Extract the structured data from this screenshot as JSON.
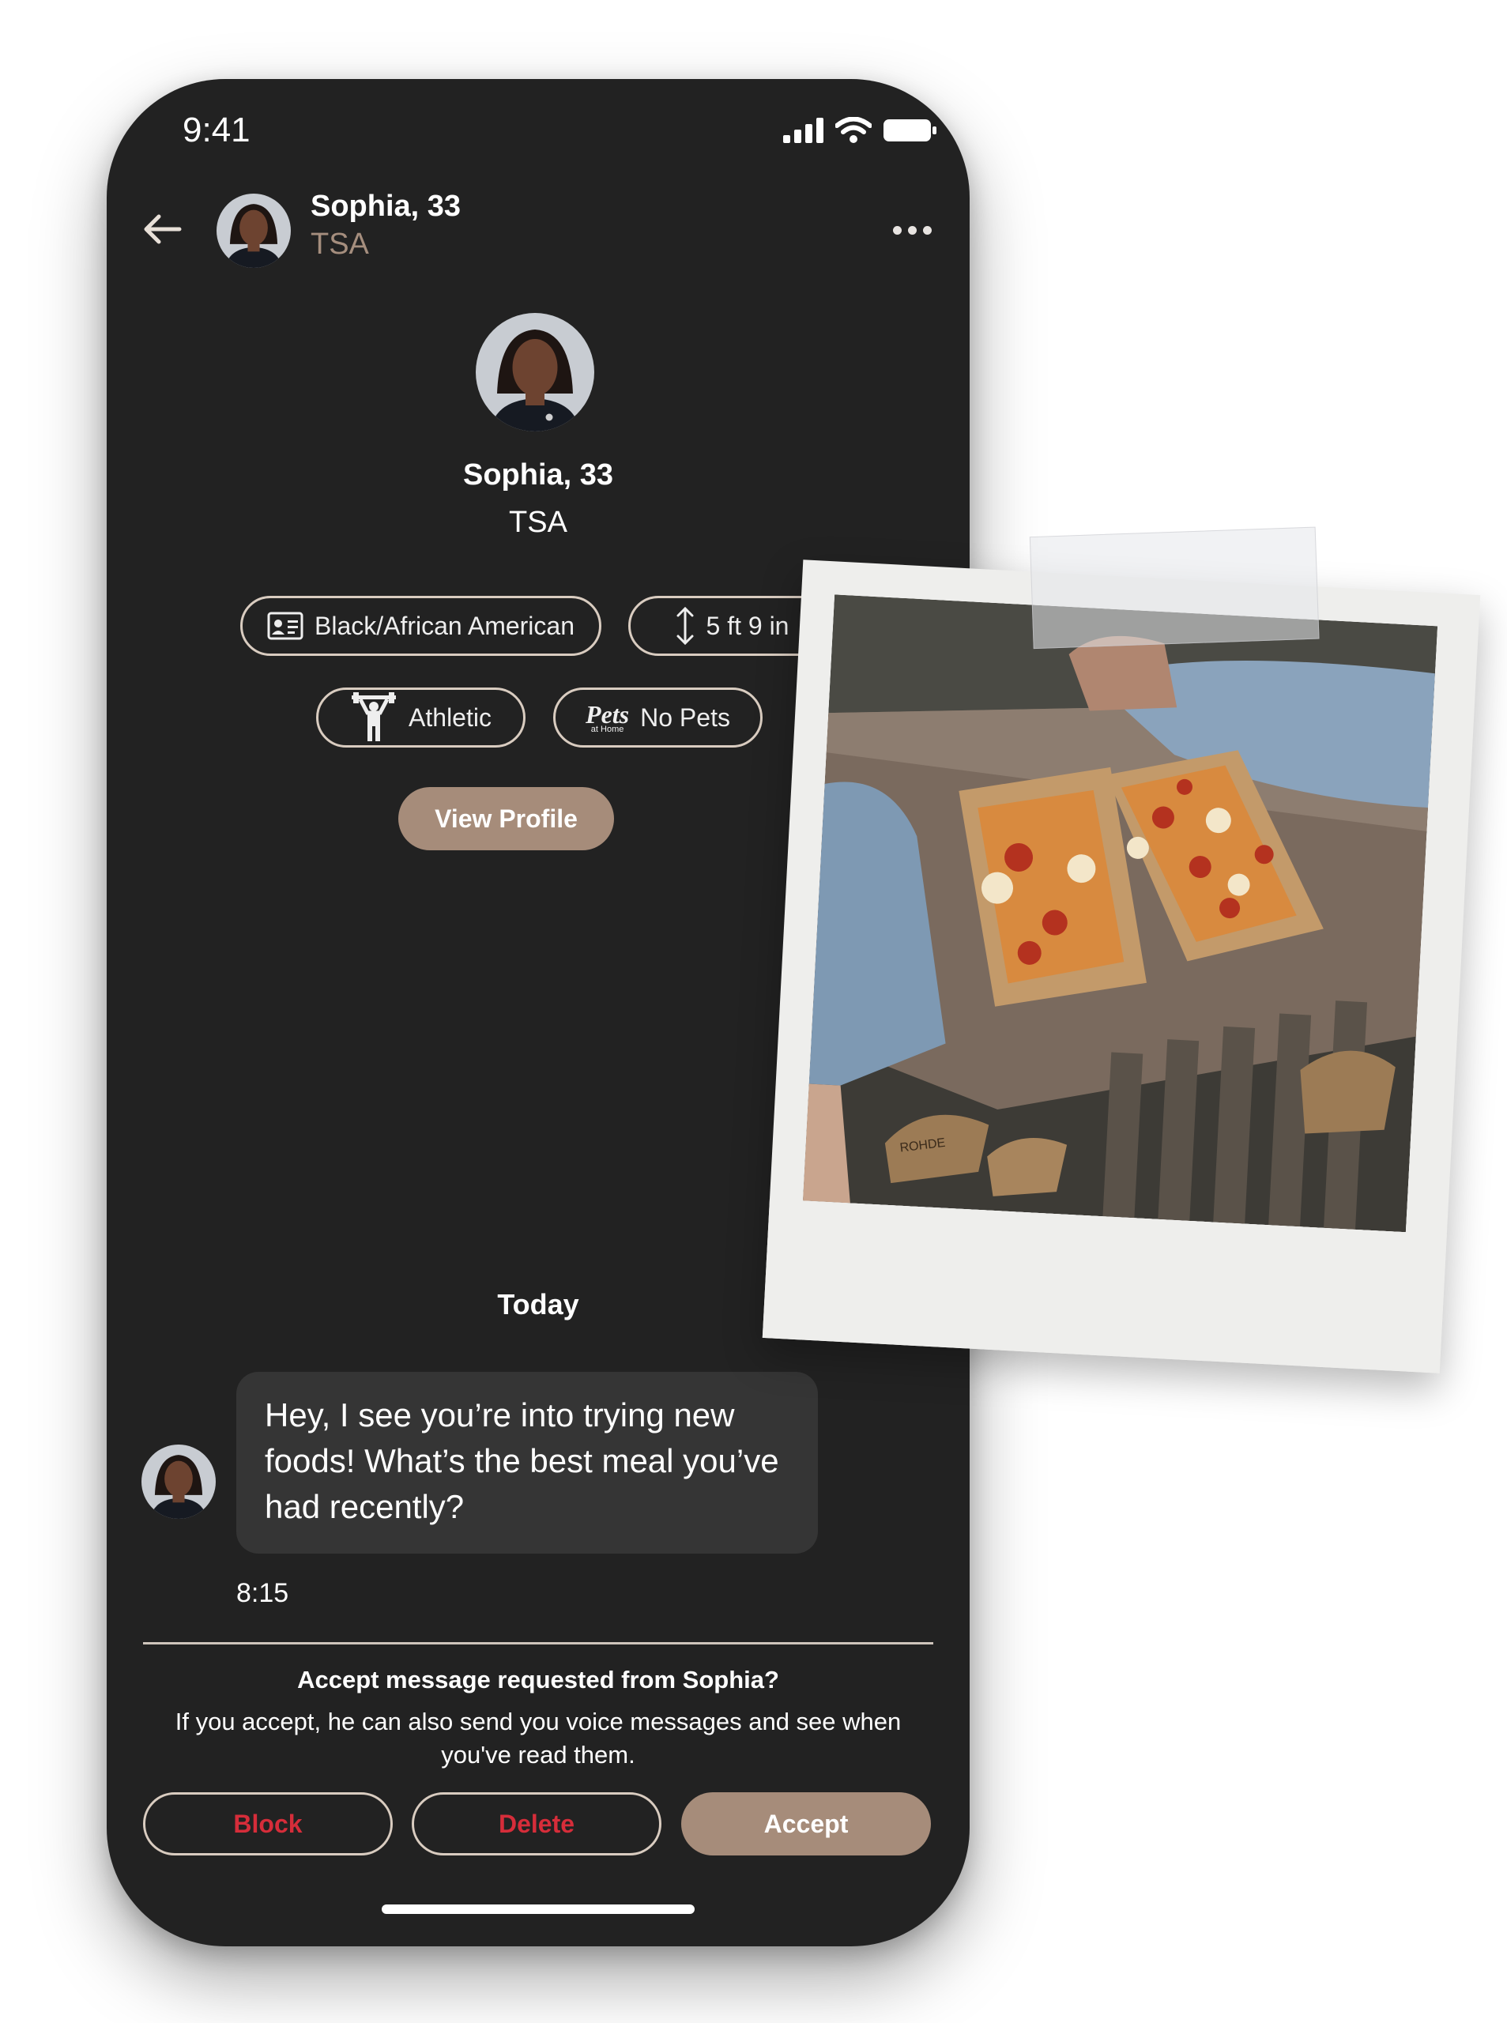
{
  "status_bar": {
    "time": "9:41"
  },
  "header": {
    "name": "Sophia, 33",
    "subtitle": "TSA"
  },
  "profile": {
    "name": "Sophia, 33",
    "subtitle": "TSA",
    "chips": [
      {
        "label": "Black/African American",
        "icon": "id-card-icon"
      },
      {
        "label": "5 ft 9 in",
        "icon": "height-arrow-icon"
      },
      {
        "label": "Athletic",
        "icon": "weightlifter-icon"
      },
      {
        "label": "No Pets",
        "icon": "pets-at-home-logo",
        "logo_text": "Pets",
        "logo_sub": "at Home"
      }
    ],
    "view_profile_label": "View Profile"
  },
  "conversation": {
    "day_label": "Today",
    "message": {
      "text": "Hey, I see you’re into trying new foods! What’s the best meal you’ve had recently?",
      "time": "8:15"
    }
  },
  "request": {
    "title": "Accept message requested from Sophia?",
    "body": "If you accept, he can also send you voice messages and see when you've read them.",
    "buttons": {
      "block": "Block",
      "delete": "Delete",
      "accept": "Accept"
    }
  },
  "polaroid": {
    "photo_subject": "two slices of pizza in paper trays on a stone ledge",
    "sandal_brand": "ROHDE"
  },
  "colors": {
    "background": "#222222",
    "accent": "#a68c7a",
    "subtle_text": "#a58e7e",
    "danger": "#d62d3a",
    "chip_border": "#d9ccc0"
  }
}
